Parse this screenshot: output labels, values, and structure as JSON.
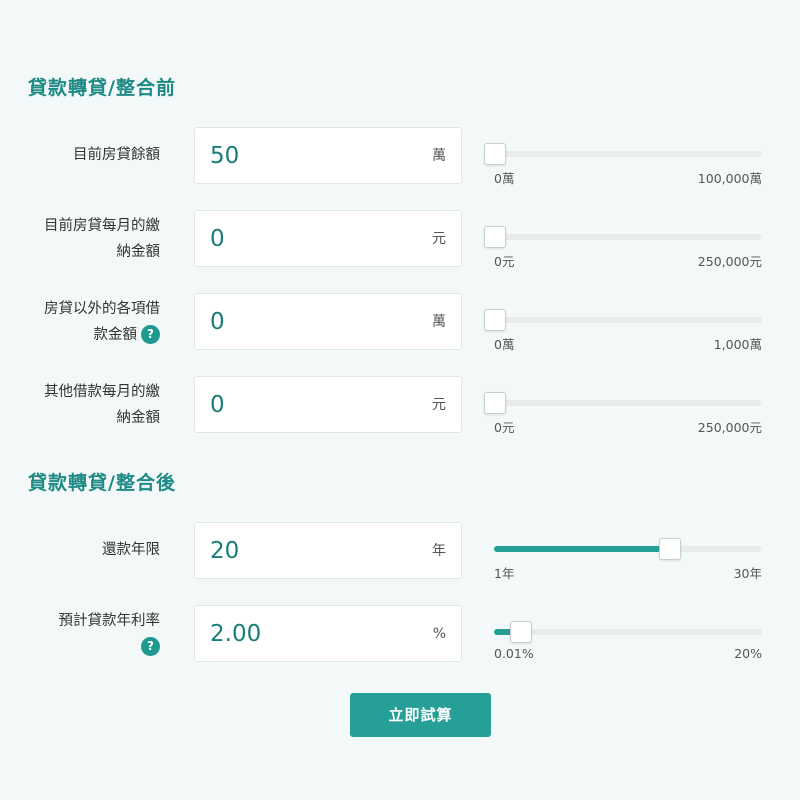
{
  "before": {
    "title": "貸款轉貸/整合前",
    "rows": [
      {
        "label_lines": [
          "目前房貸餘額"
        ],
        "has_help": false,
        "value": "50",
        "unit": "萬",
        "min_label": "0萬",
        "max_label": "100,000萬",
        "slider_fraction": 0.0005
      },
      {
        "label_lines": [
          "目前房貸每月的繳",
          "納金額"
        ],
        "has_help": false,
        "value": "0",
        "unit": "元",
        "min_label": "0元",
        "max_label": "250,000元",
        "slider_fraction": 0
      },
      {
        "label_lines": [
          "房貸以外的各項借",
          "款金額"
        ],
        "has_help": true,
        "value": "0",
        "unit": "萬",
        "min_label": "0萬",
        "max_label": "1,000萬",
        "slider_fraction": 0
      },
      {
        "label_lines": [
          "其他借款每月的繳",
          "納金額"
        ],
        "has_help": false,
        "value": "0",
        "unit": "元",
        "min_label": "0元",
        "max_label": "250,000元",
        "slider_fraction": 0
      }
    ]
  },
  "after": {
    "title": "貸款轉貸/整合後",
    "rows": [
      {
        "label_lines": [
          "還款年限"
        ],
        "has_help": false,
        "value": "20",
        "unit": "年",
        "min_label": "1年",
        "max_label": "30年",
        "slider_fraction": 0.655
      },
      {
        "label_lines": [
          "預計貸款年利率",
          ""
        ],
        "has_help": true,
        "value": "2.00",
        "unit": "%",
        "min_label": "0.01%",
        "max_label": "20%",
        "slider_fraction": 0.1
      }
    ]
  },
  "help_glyph": "?",
  "calc_button": "立即試算"
}
